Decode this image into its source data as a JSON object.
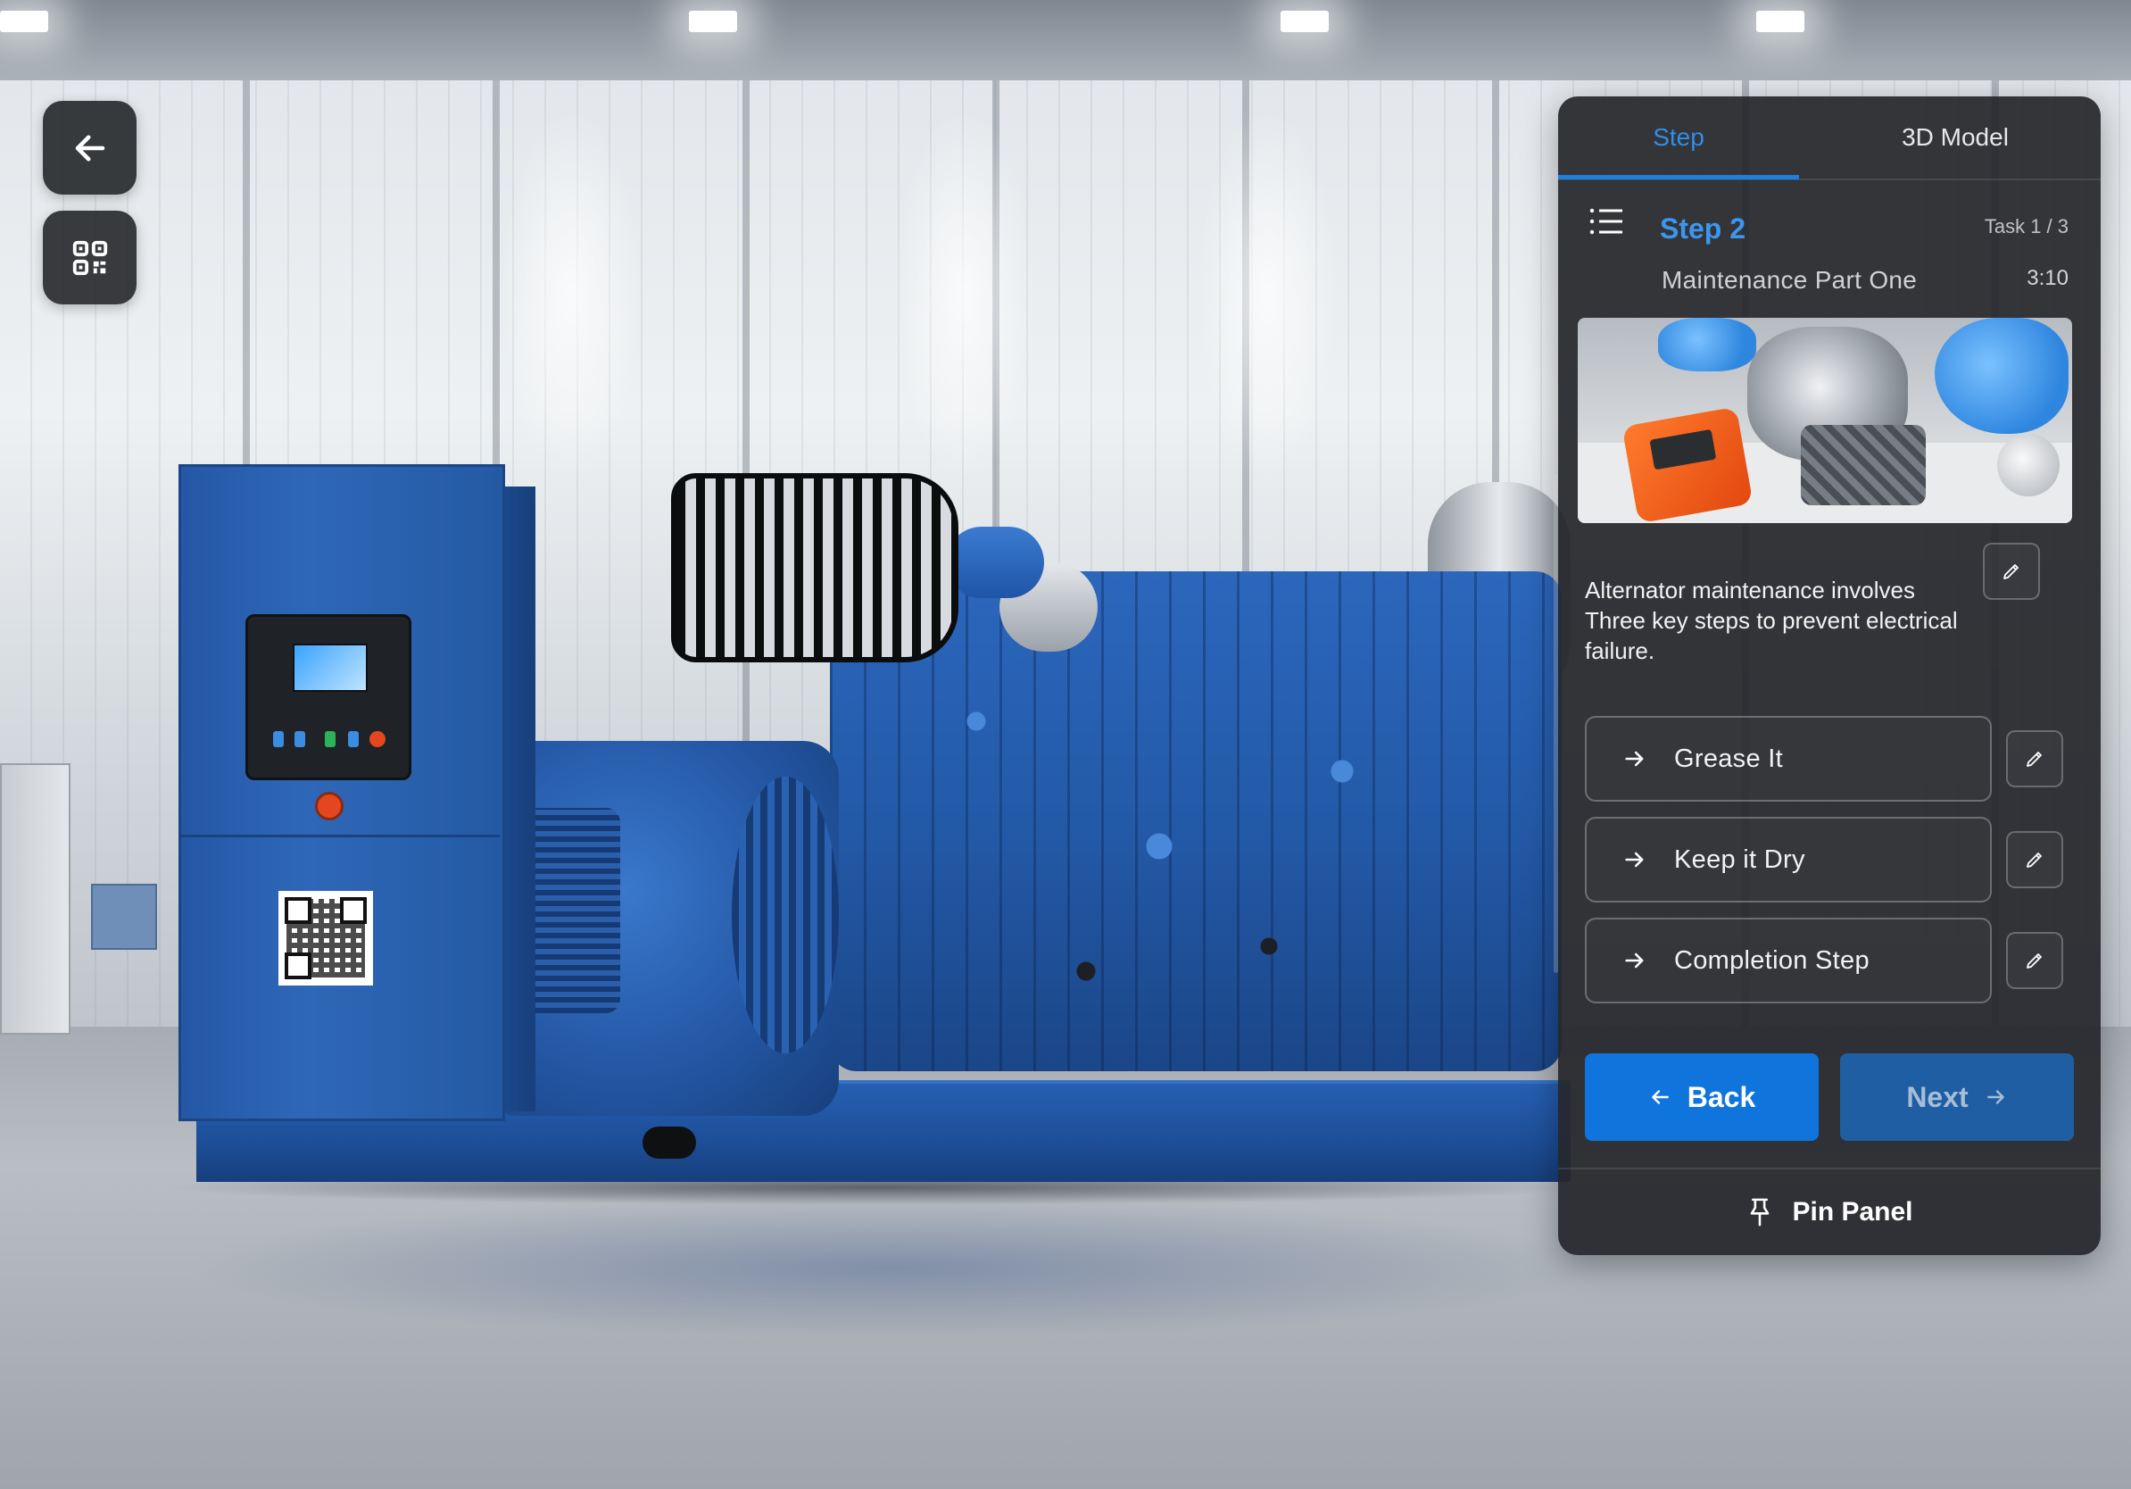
{
  "scene": {
    "background": "industrial-hall-with-blue-generator"
  },
  "left_controls": {
    "back_icon": "arrow-left-icon",
    "qr_icon": "qr-code-icon"
  },
  "panel": {
    "tabs": [
      {
        "label": "Step",
        "active": true
      },
      {
        "label": "3D Model",
        "active": false
      }
    ],
    "step": {
      "title": "Step 2",
      "subtitle": "Maintenance Part One",
      "task_count": "Task 1 / 3",
      "timer": "3:10",
      "description": "Alternator maintenance involves Three key steps to prevent electrical failure."
    },
    "options": [
      {
        "label": "Grease It"
      },
      {
        "label": "Keep it Dry"
      },
      {
        "label": "Completion Step"
      }
    ],
    "buttons": {
      "back": "Back",
      "next": "Next",
      "pin": "Pin Panel"
    }
  },
  "colors": {
    "accent": "#0f75dc",
    "panel_bg": "#26272b",
    "active_tab": "#2f8ee8"
  }
}
